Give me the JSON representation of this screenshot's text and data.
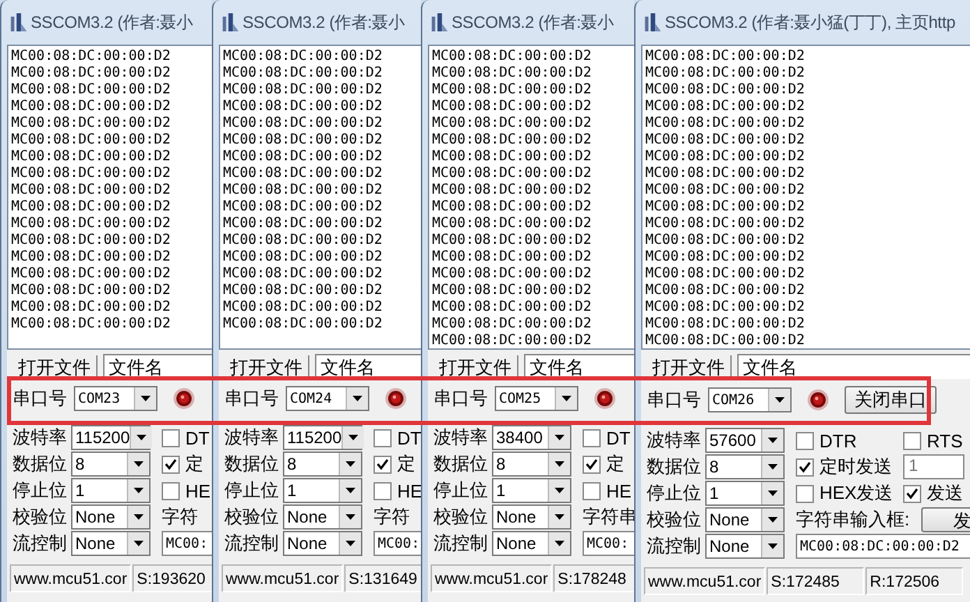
{
  "windows": [
    {
      "title": "SSCOM3.2 (作者:聂小",
      "log_lines": [
        "MC00:08:DC:00:00:D2",
        "MC00:08:DC:00:00:D2",
        "MC00:08:DC:00:00:D2",
        "MC00:08:DC:00:00:D2",
        "MC00:08:DC:00:00:D2",
        "MC00:08:DC:00:00:D2",
        "MC00:08:DC:00:00:D2",
        "MC00:08:DC:00:00:D2",
        "MC00:08:DC:00:00:D2",
        "MC00:08:DC:00:00:D2",
        "MC00:08:DC:00:00:D2",
        "MC00:08:DC:00:00:D2",
        "MC00:08:DC:00:00:D2",
        "MC00:08:DC:00:00:D2",
        "MC00:08:DC:00:00:D2",
        "MC00:08:DC:00:00:D2",
        "MC00:08:DC:00:00:D2"
      ],
      "open_file_button": "打开文件",
      "filename_field": "文件名",
      "port_label": "串口号",
      "port": "COM23",
      "settings": [
        {
          "label": "波特率",
          "value": "115200"
        },
        {
          "label": "数据位",
          "value": "8"
        },
        {
          "label": "停止位",
          "value": "1"
        },
        {
          "label": "校验位",
          "value": "None"
        },
        {
          "label": "流控制",
          "value": "None"
        }
      ],
      "option_rows": [
        [
          {
            "kind": "checkbox",
            "label": "DT",
            "checked": false
          }
        ],
        [
          {
            "kind": "checkbox",
            "label": "定",
            "checked": true
          }
        ],
        [
          {
            "kind": "checkbox",
            "label": "HE",
            "checked": false
          }
        ]
      ],
      "string_label": "字符",
      "string_value": "MC00:",
      "status": [
        "www.mcu51.cor",
        "S:193620"
      ]
    },
    {
      "title": "SSCOM3.2 (作者:聂小",
      "log_lines": [
        "MC00:08:DC:00:00:D2",
        "MC00:08:DC:00:00:D2",
        "MC00:08:DC:00:00:D2",
        "MC00:08:DC:00:00:D2",
        "MC00:08:DC:00:00:D2",
        "MC00:08:DC:00:00:D2",
        "MC00:08:DC:00:00:D2",
        "MC00:08:DC:00:00:D2",
        "MC00:08:DC:00:00:D2",
        "MC00:08:DC:00:00:D2",
        "MC00:08:DC:00:00:D2",
        "MC00:08:DC:00:00:D2",
        "MC00:08:DC:00:00:D2",
        "MC00:08:DC:00:00:D2",
        "MC00:08:DC:00:00:D2",
        "MC00:08:DC:00:00:D2",
        "MC00:08:DC:00:00:D2"
      ],
      "open_file_button": "打开文件",
      "filename_field": "文件名",
      "port_label": "串口号",
      "port": "COM24",
      "settings": [
        {
          "label": "波特率",
          "value": "115200"
        },
        {
          "label": "数据位",
          "value": "8"
        },
        {
          "label": "停止位",
          "value": "1"
        },
        {
          "label": "校验位",
          "value": "None"
        },
        {
          "label": "流控制",
          "value": "None"
        }
      ],
      "option_rows": [
        [
          {
            "kind": "checkbox",
            "label": "DT",
            "checked": false
          }
        ],
        [
          {
            "kind": "checkbox",
            "label": "定",
            "checked": true
          }
        ],
        [
          {
            "kind": "checkbox",
            "label": "HE",
            "checked": false
          }
        ]
      ],
      "string_label": "字符",
      "string_value": "MC00:",
      "status": [
        "www.mcu51.cor",
        "S:131649"
      ]
    },
    {
      "title": "SSCOM3.2 (作者:聂小",
      "log_lines": [
        "MC00:08:DC:00:00:D2",
        "MC00:08:DC:00:00:D2",
        "MC00:08:DC:00:00:D2",
        "MC00:08:DC:00:00:D2",
        "MC00:08:DC:00:00:D2",
        "MC00:08:DC:00:00:D2",
        "MC00:08:DC:00:00:D2",
        "MC00:08:DC:00:00:D2",
        "MC00:08:DC:00:00:D2",
        "MC00:08:DC:00:00:D2",
        "MC00:08:DC:00:00:D2",
        "MC00:08:DC:00:00:D2",
        "MC00:08:DC:00:00:D2",
        "MC00:08:DC:00:00:D2",
        "MC00:08:DC:00:00:D2",
        "MC00:08:DC:00:00:D2",
        "MC00:08:DC:00:00:D2",
        "MC00:08:DC:00:00:D2"
      ],
      "open_file_button": "打开文件",
      "filename_field": "文件名",
      "port_label": "串口号",
      "port": "COM25",
      "settings": [
        {
          "label": "波特率",
          "value": "38400"
        },
        {
          "label": "数据位",
          "value": "8"
        },
        {
          "label": "停止位",
          "value": "1"
        },
        {
          "label": "校验位",
          "value": "None"
        },
        {
          "label": "流控制",
          "value": "None"
        }
      ],
      "option_rows": [
        [
          {
            "kind": "checkbox",
            "label": "DT",
            "checked": false
          }
        ],
        [
          {
            "kind": "checkbox",
            "label": "定",
            "checked": true
          }
        ],
        [
          {
            "kind": "checkbox",
            "label": "HE",
            "checked": false
          }
        ]
      ],
      "string_label": "字符串",
      "string_value": "MC00:",
      "status": [
        "www.mcu51.cor",
        "S:178248"
      ]
    },
    {
      "title": "SSCOM3.2 (作者:聂小猛(丁丁), 主页http",
      "log_lines": [
        "MC00:08:DC:00:00:D2",
        "MC00:08:DC:00:00:D2",
        "MC00:08:DC:00:00:D2",
        "MC00:08:DC:00:00:D2",
        "MC00:08:DC:00:00:D2",
        "MC00:08:DC:00:00:D2",
        "MC00:08:DC:00:00:D2",
        "MC00:08:DC:00:00:D2",
        "MC00:08:DC:00:00:D2",
        "MC00:08:DC:00:00:D2",
        "MC00:08:DC:00:00:D2",
        "MC00:08:DC:00:00:D2",
        "MC00:08:DC:00:00:D2",
        "MC00:08:DC:00:00:D2",
        "MC00:08:DC:00:00:D2",
        "MC00:08:DC:00:00:D2",
        "MC00:08:DC:00:00:D2",
        "MC00:08:DC:00:00:D2"
      ],
      "open_file_button": "打开文件",
      "filename_field": "文件名",
      "port_label": "串口号",
      "port": "COM26",
      "close_button": "关闭串口",
      "settings": [
        {
          "label": "波特率",
          "value": "57600"
        },
        {
          "label": "数据位",
          "value": "8"
        },
        {
          "label": "停止位",
          "value": "1"
        },
        {
          "label": "校验位",
          "value": "None"
        },
        {
          "label": "流控制",
          "value": "None"
        }
      ],
      "option_rows": [
        [
          {
            "kind": "checkbox",
            "label": "DTR",
            "checked": false
          },
          {
            "kind": "checkbox",
            "label": "RTS",
            "checked": false
          }
        ],
        [
          {
            "kind": "checkbox",
            "label": "定时发送",
            "checked": true
          },
          {
            "kind": "field",
            "value": "1",
            "disabled": true
          }
        ],
        [
          {
            "kind": "checkbox",
            "label": "HEX发送",
            "checked": false
          },
          {
            "kind": "checkbox",
            "label": "发送",
            "checked": true
          }
        ]
      ],
      "string_label": "字符串输入框:",
      "send_button": "发",
      "string_value": "MC00:08:DC:00:00:D2",
      "status": [
        "www.mcu51.cor",
        "S:172485",
        "R:172506"
      ]
    }
  ],
  "highlight": true
}
